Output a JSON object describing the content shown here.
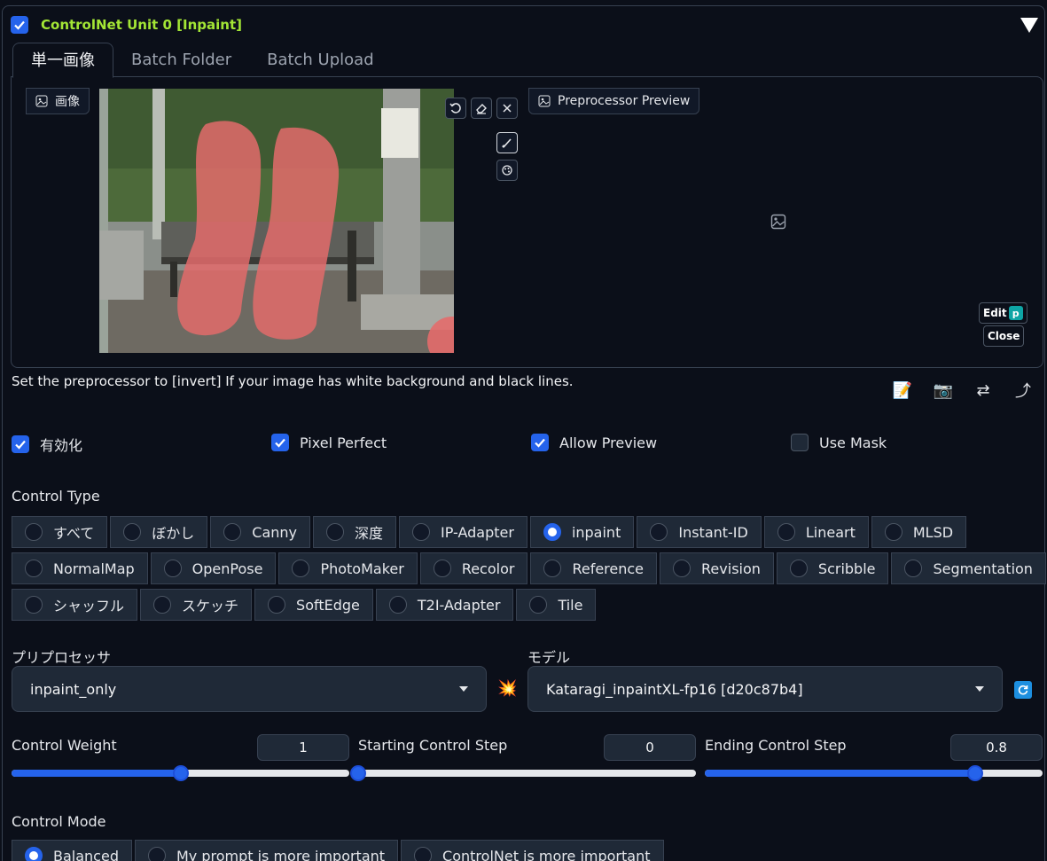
{
  "unit": {
    "enabled": true,
    "title": "ControlNet Unit 0  [Inpaint]"
  },
  "tabs": [
    "単一画像",
    "Batch Folder",
    "Batch Upload"
  ],
  "image_panel": {
    "input_label": "画像",
    "preview_label": "Preprocessor Preview",
    "edit_label": "Edit",
    "close_label": "Close"
  },
  "hint": "Set the preprocessor to [invert] If your image has white background and black lines.",
  "options": [
    {
      "label": "有効化",
      "checked": true
    },
    {
      "label": "Pixel Perfect",
      "checked": true
    },
    {
      "label": "Allow Preview",
      "checked": true
    },
    {
      "label": "Use Mask",
      "checked": false
    }
  ],
  "control_type": {
    "label": "Control Type",
    "selected": "inpaint",
    "rows": [
      [
        "すべて",
        "ぼかし",
        "Canny",
        "深度",
        "IP-Adapter",
        "inpaint",
        "Instant-ID",
        "Lineart",
        "MLSD"
      ],
      [
        "NormalMap",
        "OpenPose",
        "PhotoMaker",
        "Recolor",
        "Reference",
        "Revision",
        "Scribble",
        "Segmentation"
      ],
      [
        "シャッフル",
        "スケッチ",
        "SoftEdge",
        "T2I-Adapter",
        "Tile"
      ]
    ]
  },
  "preprocessor": {
    "label": "プリプロセッサ",
    "value": "inpaint_only"
  },
  "model": {
    "label": "モデル",
    "value": "Kataragi_inpaintXL-fp16 [d20c87b4]"
  },
  "sliders": [
    {
      "label": "Control Weight",
      "value": "1",
      "fraction": 0.5
    },
    {
      "label": "Starting Control Step",
      "value": "0",
      "fraction": 0.0
    },
    {
      "label": "Ending Control Step",
      "value": "0.8",
      "fraction": 0.8
    }
  ],
  "control_mode": {
    "label": "Control Mode",
    "selected": "Balanced",
    "options": [
      "Balanced",
      "My prompt is more important",
      "ControlNet is more important"
    ]
  },
  "colors": {
    "accent": "#2563eb",
    "title": "#a3e635",
    "mask": "#e36b6b"
  }
}
